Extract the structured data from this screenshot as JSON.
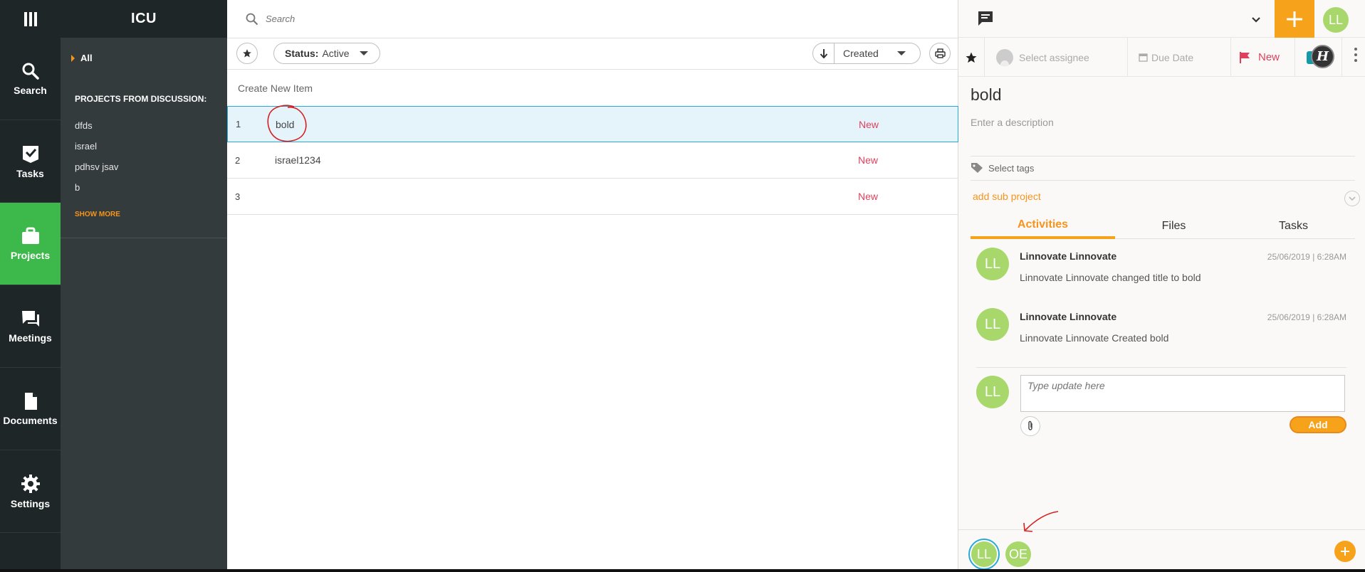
{
  "app": {
    "name": "ICU"
  },
  "rail": {
    "items": [
      {
        "label": "Search",
        "icon": "search-icon"
      },
      {
        "label": "Tasks",
        "icon": "check-icon"
      },
      {
        "label": "Projects",
        "icon": "briefcase-icon"
      },
      {
        "label": "Meetings",
        "icon": "chat-icon"
      },
      {
        "label": "Documents",
        "icon": "document-icon"
      },
      {
        "label": "Settings",
        "icon": "gear-icon"
      }
    ],
    "active": "Projects"
  },
  "panel": {
    "all_label": "All",
    "section_title": "PROJECTS FROM DISCUSSION:",
    "projects": [
      "dfds",
      "israel",
      "pdhsv jsav",
      "b"
    ],
    "show_more": "SHOW MORE"
  },
  "list": {
    "search_placeholder": "Search",
    "status_prefix": "Status:",
    "status_value": "Active",
    "sort_value": "Created",
    "create_label": "Create New Item",
    "rows": [
      {
        "num": "1",
        "title": "bold",
        "status": "New"
      },
      {
        "num": "2",
        "title": "israel1234",
        "status": "New"
      },
      {
        "num": "3",
        "title": "",
        "status": "New"
      }
    ]
  },
  "detail": {
    "user_initials": "LL",
    "assignee_placeholder": "Select assignee",
    "due_date_placeholder": "Due Date",
    "status": "New",
    "title": "bold",
    "description_placeholder": "Enter a description",
    "tags_placeholder": "Select tags",
    "sub_project_label": "add sub project",
    "tabs": [
      "Activities",
      "Files",
      "Tasks"
    ],
    "activities": [
      {
        "initials": "LL",
        "who": "Linnovate Linnovate",
        "when": "25/06/2019 | 6:28AM",
        "what": "Linnovate Linnovate changed title to bold"
      },
      {
        "initials": "LL",
        "who": "Linnovate Linnovate",
        "when": "25/06/2019 | 6:28AM",
        "what": "Linnovate Linnovate Created bold"
      }
    ],
    "compose_initials": "LL",
    "compose_placeholder": "Type update here",
    "add_label": "Add",
    "watchers": [
      "LL",
      "OE"
    ]
  },
  "colors": {
    "accent_orange": "#f7a21b",
    "active_green": "#3cb94a",
    "status_red": "#e0405e",
    "avatar_green": "#a8d86b",
    "selection_blue": "#28a9d9"
  }
}
